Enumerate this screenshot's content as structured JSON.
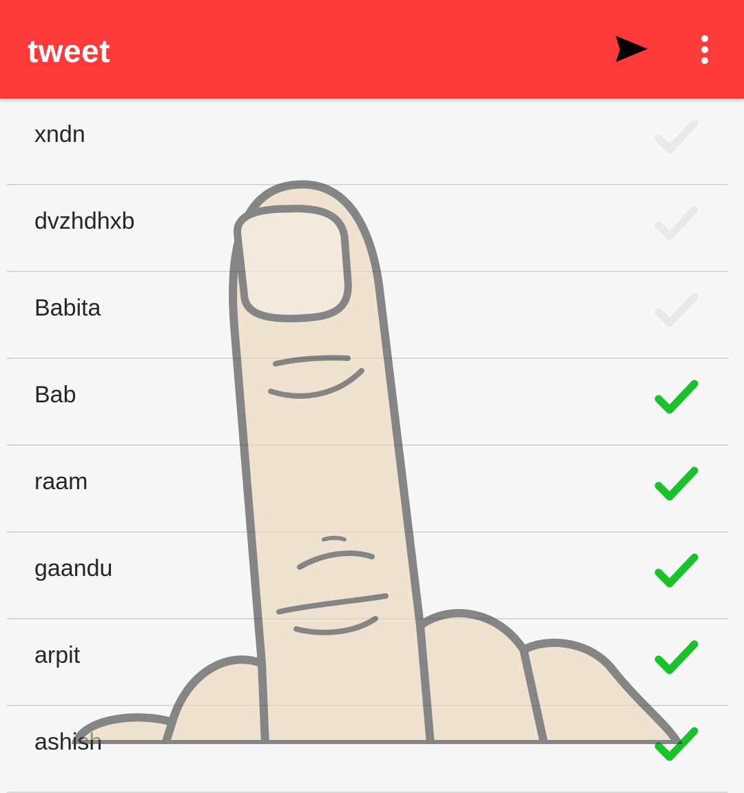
{
  "app": {
    "title": "tweet"
  },
  "toolbar": {
    "send_icon": "send-icon",
    "overflow_icon": "more-vert-icon"
  },
  "colors": {
    "appbar": "#fc3a3a",
    "check_on": "#19c22a",
    "check_off": "#e9e9e9",
    "divider": "#d9d9d9",
    "background": "#f7f7f7"
  },
  "list": {
    "items": [
      {
        "name": "xndn",
        "checked": false
      },
      {
        "name": "dvzhdhxb",
        "checked": false
      },
      {
        "name": "Babita",
        "checked": false
      },
      {
        "name": "Bab",
        "checked": true
      },
      {
        "name": "raam",
        "checked": true
      },
      {
        "name": "gaandu",
        "checked": true
      },
      {
        "name": "arpit",
        "checked": true
      },
      {
        "name": "ashish",
        "checked": true
      }
    ]
  },
  "overlay": {
    "image": "middle-finger-hand-image"
  }
}
